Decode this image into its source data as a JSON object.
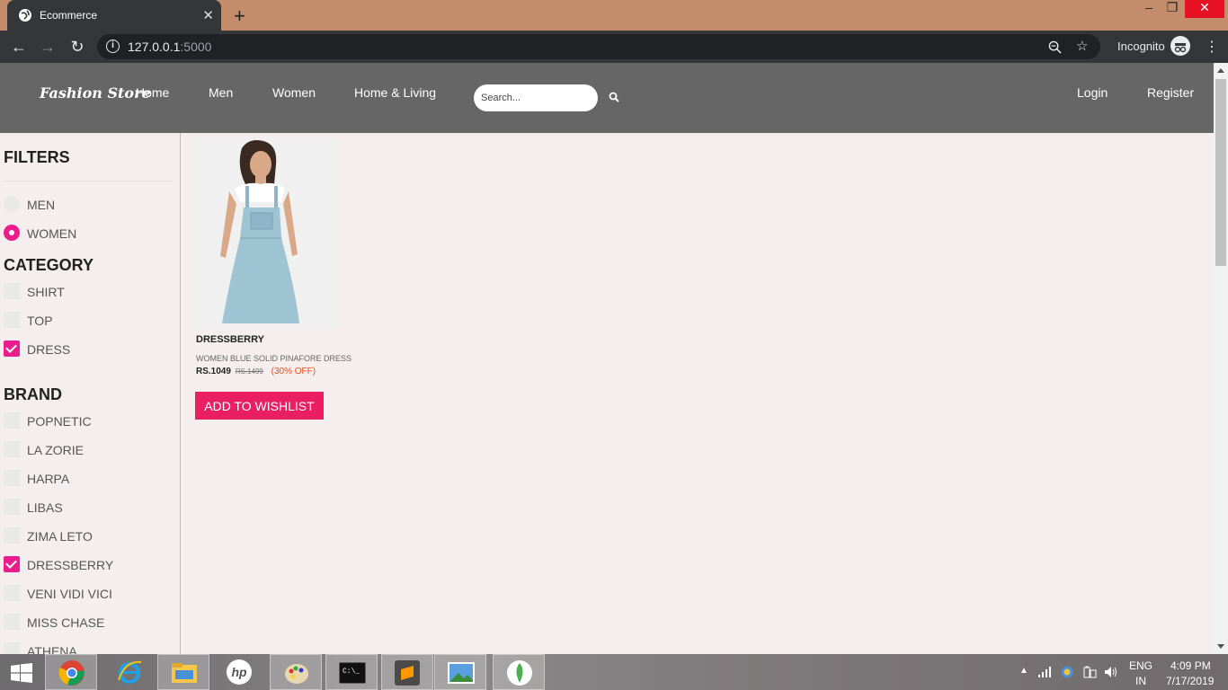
{
  "browser": {
    "tab_title": "Ecommerce",
    "url_host": "127.0.0.1",
    "url_port": ":5000",
    "incognito_label": "Incognito"
  },
  "site": {
    "logo": "Fashion Store",
    "nav": [
      "Home",
      "Men",
      "Women",
      "Home & Living"
    ],
    "search_placeholder": "Search...",
    "login": "Login",
    "register": "Register"
  },
  "filters": {
    "heading": "FILTERS",
    "gender": [
      {
        "label": "MEN",
        "selected": false
      },
      {
        "label": "WOMEN",
        "selected": true
      }
    ],
    "category_heading": "CATEGORY",
    "categories": [
      {
        "label": "SHIRT",
        "checked": false
      },
      {
        "label": "TOP",
        "checked": false
      },
      {
        "label": "DRESS",
        "checked": true
      }
    ],
    "brand_heading": "BRAND",
    "brands": [
      {
        "label": "POPNETIC",
        "checked": false
      },
      {
        "label": "LA ZORIE",
        "checked": false
      },
      {
        "label": "HARPA",
        "checked": false
      },
      {
        "label": "LIBAS",
        "checked": false
      },
      {
        "label": "ZIMA LETO",
        "checked": false
      },
      {
        "label": "DRESSBERRY",
        "checked": true
      },
      {
        "label": "VENI VIDI VICI",
        "checked": false
      },
      {
        "label": "MISS CHASE",
        "checked": false
      },
      {
        "label": "ATHENA",
        "checked": false
      }
    ]
  },
  "product": {
    "brand": "DRESSBERRY",
    "name": "WOMEN BLUE SOLID PINAFORE DRESS",
    "price": "RS.1049",
    "mrp": "RS.1499",
    "discount": "(30% OFF)",
    "wishlist_button": "ADD TO WISHLIST"
  },
  "taskbar": {
    "language": "ENG",
    "region": "IN",
    "time": "4:09 PM",
    "date": "7/17/2019"
  },
  "colors": {
    "accent": "#e91e8c",
    "wishlist": "#e91e63",
    "header": "#666666"
  }
}
